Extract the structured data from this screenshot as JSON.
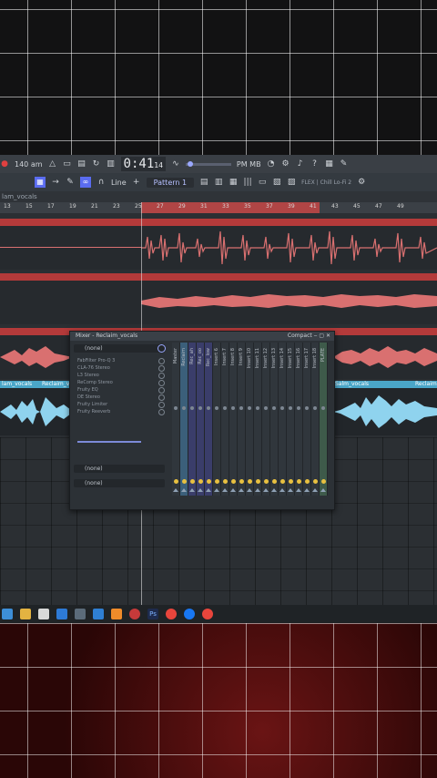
{
  "toolbar": {
    "tempo": "140",
    "tempo_unit": "am",
    "time": "0:41",
    "time_sub": "14",
    "snap": "Line",
    "pattern": "Pattern 1",
    "cpu_label": "PM MB",
    "plugin_info": "FLEX | Chill Lo-Fi 2"
  },
  "clip_row_label": "lam_vocals",
  "ruler_ticks": [
    "13",
    "15",
    "17",
    "19",
    "21",
    "23",
    "25",
    "27",
    "29",
    "31",
    "33",
    "35",
    "37",
    "39",
    "41",
    "43",
    "45",
    "47",
    "49"
  ],
  "tracks": {
    "blue_clips": [
      "lam_vocals",
      "Reclaim_vo",
      "Salm_vocals",
      "Reclaim"
    ]
  },
  "mixer": {
    "title": "Mixer - Reclaim_vocals",
    "mode": "Compact",
    "slot_top": "(none)",
    "fx_list": [
      "FabFilter Pro-Q 3",
      "CLA-76 Stereo",
      "L3 Stereo",
      "ReComp Stereo",
      "Fruity EQ",
      "DE Stereo",
      "Fruity Limiter",
      "Fruity Reeverb"
    ],
    "slot_bottom_1": "(none)",
    "slot_bottom_2": "(none)",
    "strips": [
      "Master",
      "Reclaim",
      "Rec_ah",
      "Rec_oo",
      "Rec_low",
      "Insert 6",
      "Insert 7",
      "Insert 8",
      "Insert 9",
      "Insert 10",
      "Insert 11",
      "Insert 12",
      "Insert 13",
      "Insert 14",
      "Insert 15",
      "Insert 16",
      "Insert 17",
      "Insert 18",
      "PLATE"
    ]
  },
  "colors": {
    "accent": "#5a6cf0",
    "red_track": "#b43a3a",
    "blue_clip": "#4aa6c8"
  }
}
